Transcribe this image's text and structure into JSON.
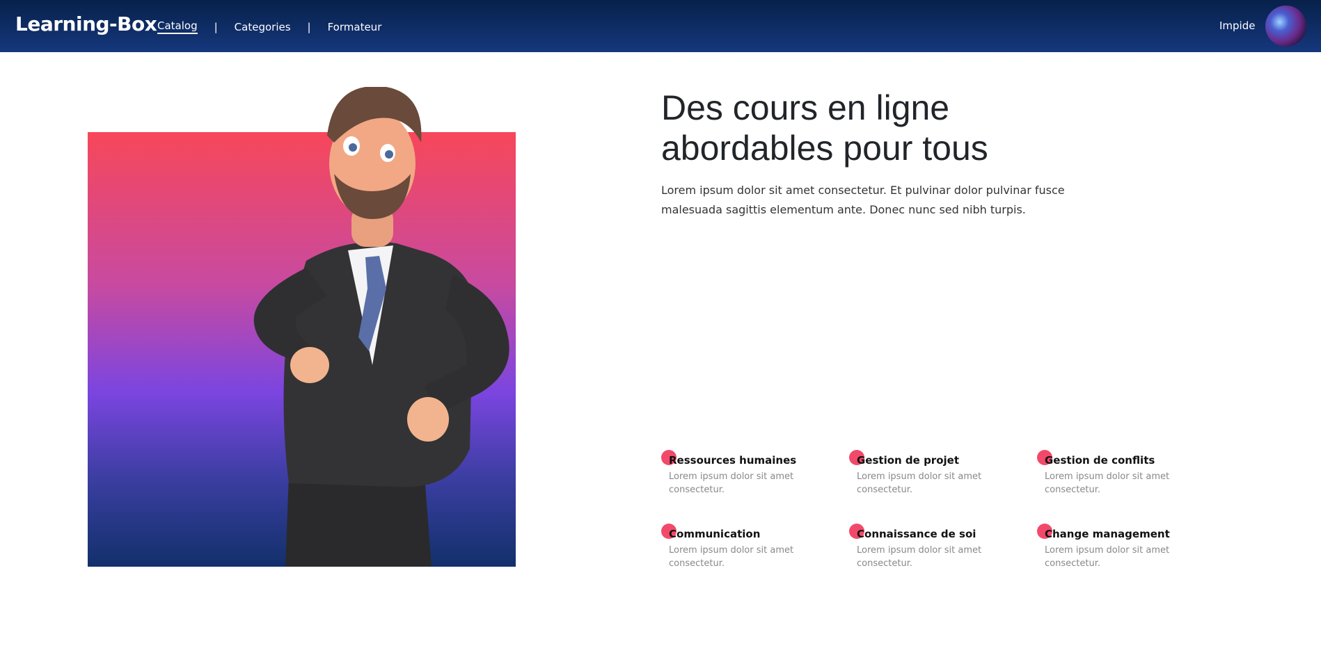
{
  "nav": {
    "brand": "Learning-Box",
    "links": [
      "Catalog",
      "Categories",
      "Formateur"
    ],
    "separator": "|",
    "user": "Impide"
  },
  "hero": {
    "title": "Des cours en ligne abordables pour tous",
    "text": "Lorem ipsum dolor sit amet consectetur. Et pulvinar dolor pulvinar fusce malesuada sagittis elementum ante. Donec nunc sed nibh turpis."
  },
  "features": [
    {
      "title": "Ressources humaines",
      "desc": "Lorem ipsum dolor sit amet consectetur."
    },
    {
      "title": "Gestion de projet",
      "desc": "Lorem ipsum dolor sit amet consectetur."
    },
    {
      "title": "Gestion de conflits",
      "desc": "Lorem ipsum dolor sit amet consectetur."
    },
    {
      "title": "Communication",
      "desc": "Lorem ipsum dolor sit amet consectetur."
    },
    {
      "title": "Connaissance de soi",
      "desc": "Lorem ipsum dolor sit amet consectetur."
    },
    {
      "title": "Change management",
      "desc": "Lorem ipsum dolor sit amet consectetur."
    }
  ],
  "colors": {
    "nav": "#0b2658",
    "accent": "#f2496a",
    "gradient_top": "#f7475a",
    "gradient_mid": "#7b45e0",
    "gradient_bottom": "#12306b"
  }
}
